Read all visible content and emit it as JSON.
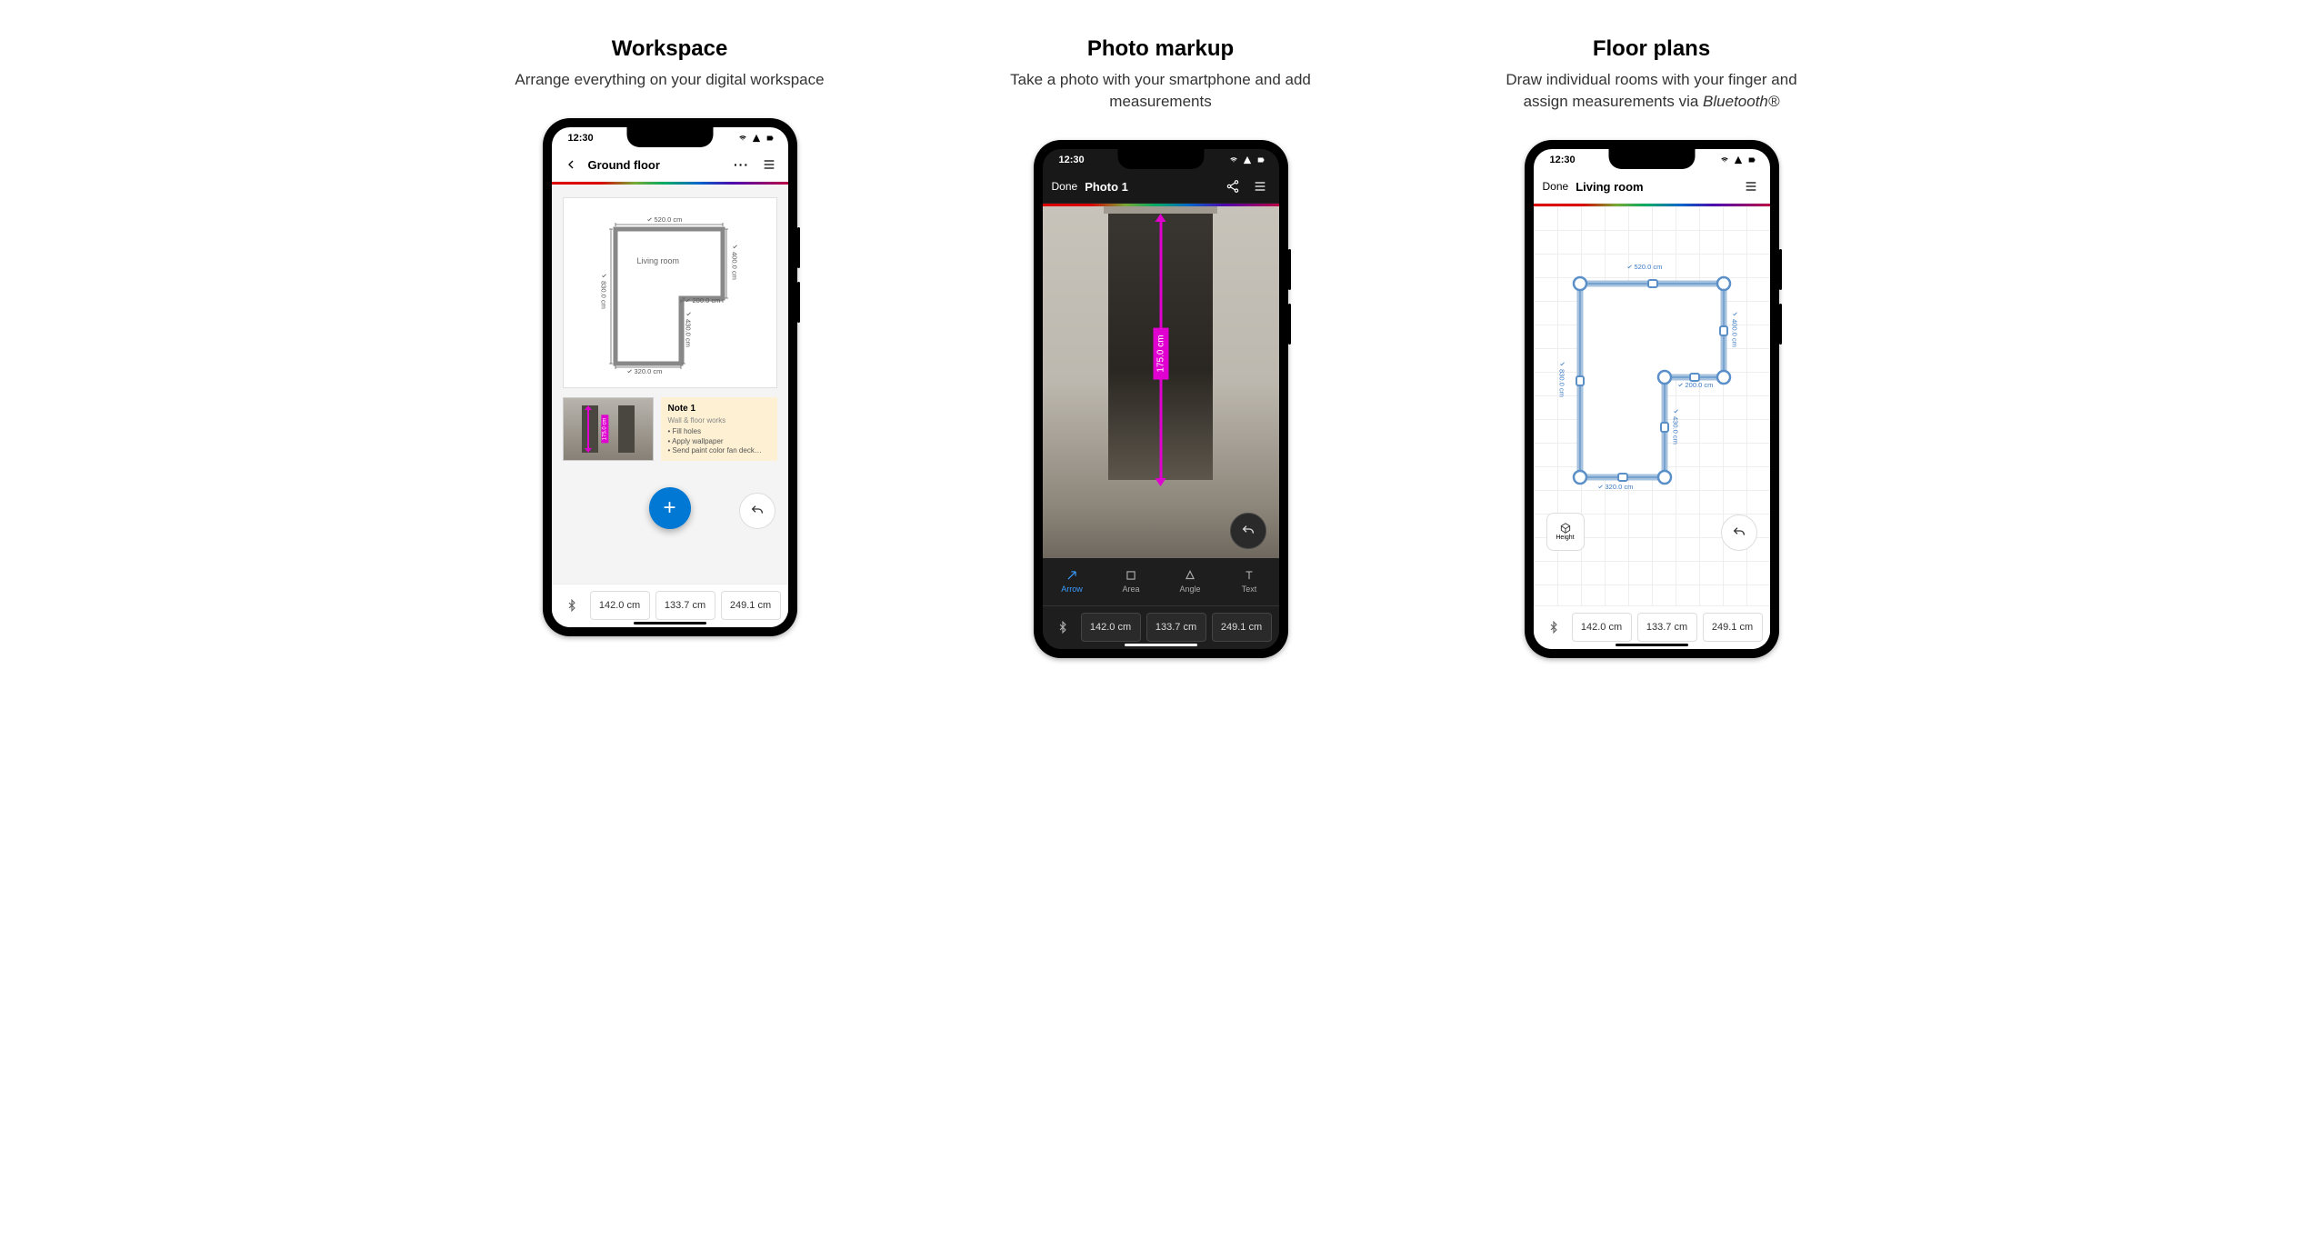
{
  "features": [
    {
      "title": "Workspace",
      "subtitle": "Arrange everything on your digital workspace"
    },
    {
      "title": "Photo markup",
      "subtitle": "Take a photo with your smartphone and add measurements"
    },
    {
      "title": "Floor plans",
      "subtitle_html": "Draw individual rooms with your finger and assign measurements via Bluetooth®"
    }
  ],
  "status": {
    "time": "12:30"
  },
  "workspace": {
    "header": "Ground floor",
    "room": {
      "name": "Living room",
      "dims": {
        "top": "520.0 cm",
        "left": "830.0 cm",
        "right_upper": "400.0 cm",
        "notch_top": "200.0 cm",
        "notch_right": "430.0 cm",
        "bottom": "320.0 cm"
      }
    },
    "note": {
      "title": "Note 1",
      "subtitle": "Wall & floor works",
      "items": [
        "Fill holes",
        "Apply wallpaper",
        "Send paint color fan deck…"
      ]
    },
    "thumb_label": "175.0 cm",
    "add_label": "+"
  },
  "photo": {
    "done": "Done",
    "title": "Photo 1",
    "annotation": "175.0 cm",
    "tools": [
      {
        "name": "Arrow",
        "active": true
      },
      {
        "name": "Area",
        "active": false
      },
      {
        "name": "Angle",
        "active": false
      },
      {
        "name": "Text",
        "active": false
      }
    ]
  },
  "floorplan": {
    "done": "Done",
    "title": "Living room",
    "dims": {
      "top": "520.0 cm",
      "left": "830.0 cm",
      "right_upper": "400.0 cm",
      "notch_top": "200.0 cm",
      "notch_right": "430.0 cm",
      "bottom": "320.0 cm"
    },
    "height_label": "Height"
  },
  "measurements": [
    "142.0 cm",
    "133.7 cm",
    "249.1 cm"
  ]
}
